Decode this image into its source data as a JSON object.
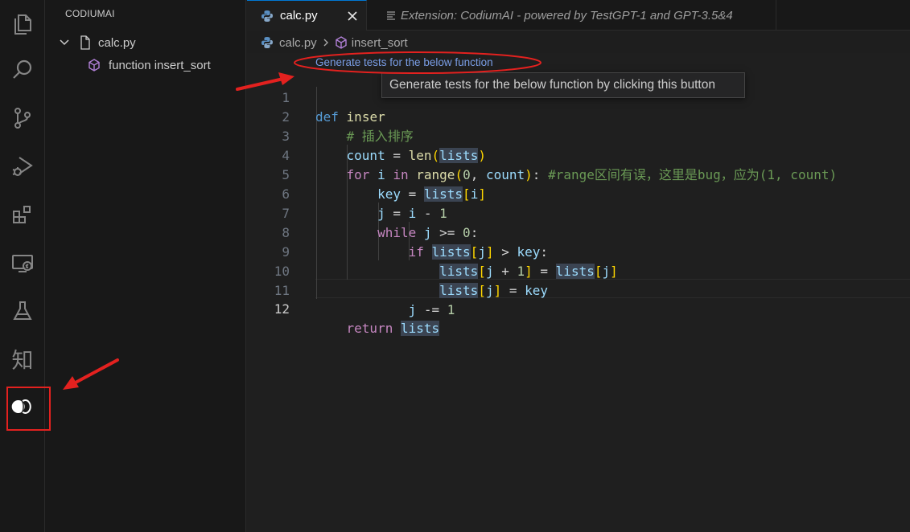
{
  "activity_bar": {
    "items": [
      {
        "name": "explorer",
        "icon": "files-icon"
      },
      {
        "name": "search",
        "icon": "search-icon"
      },
      {
        "name": "source-control",
        "icon": "source-control-icon"
      },
      {
        "name": "run-debug",
        "icon": "run-debug-icon"
      },
      {
        "name": "extensions",
        "icon": "extensions-icon"
      },
      {
        "name": "remote-explorer",
        "icon": "remote-explorer-icon"
      },
      {
        "name": "testing",
        "icon": "flask-icon"
      },
      {
        "name": "zhihu",
        "icon": "zhihu-icon",
        "glyph": "知"
      },
      {
        "name": "codiumai",
        "icon": "codiumai-icon"
      }
    ]
  },
  "sidebar": {
    "title": "CODIUMAI",
    "file": {
      "name": "calc.py"
    },
    "symbol": {
      "label": "function insert_sort"
    }
  },
  "tabs": [
    {
      "label": "calc.py",
      "active": true
    },
    {
      "label": "Extension: CodiumAI - powered by TestGPT-1 and GPT-3.5&4",
      "active": false
    }
  ],
  "breadcrumb": {
    "file": "calc.py",
    "symbol": "insert_sort"
  },
  "codelens": {
    "label": "Generate tests for the below function"
  },
  "tooltip": {
    "text": "Generate tests for the below function by clicking this button"
  },
  "code": {
    "line_numbers": [
      "1",
      "2",
      "3",
      "4",
      "5",
      "6",
      "7",
      "8",
      "9",
      "10",
      "11",
      "12"
    ],
    "current_line": "12",
    "line1": {
      "def": "def",
      "name": "inser"
    },
    "line2": {
      "comment": "# 插入排序"
    },
    "line3": {
      "var": "count",
      "eq": " = ",
      "fn": "len",
      "open": "(",
      "arg": "lists",
      "close": ")"
    },
    "line4": {
      "for": "for",
      "i": "i",
      "in": "in",
      "fn": "range",
      "open": "(",
      "zero": "0",
      "comma": ", ",
      "count": "count",
      "close": ")",
      "colon": ":",
      "comment": "#range区间有误，这里是bug，应为(1, count)"
    },
    "line5": {
      "key": "key",
      "eq": " = ",
      "lists": "lists",
      "lb": "[",
      "i": "i",
      "rb": "]"
    },
    "line6": {
      "j": "j",
      "eq": " = ",
      "i": "i",
      "minus": " - ",
      "one": "1"
    },
    "line7": {
      "while": "while",
      "j": "j",
      "op": " >= ",
      "zero": "0",
      "colon": ":"
    },
    "line8": {
      "if": "if",
      "lists": "lists",
      "lb": "[",
      "j": "j",
      "rb": "]",
      "op": " > ",
      "key": "key",
      "colon": ":"
    },
    "line9": {
      "lists": "lists",
      "lb": "[",
      "j": "j",
      "plus": " + ",
      "one": "1",
      "rb": "]",
      "eq": " = ",
      "lists2": "lists",
      "lb2": "[",
      "j2": "j",
      "rb2": "]"
    },
    "line10": {
      "lists": "lists",
      "lb": "[",
      "j": "j",
      "rb": "]",
      "eq": " = ",
      "key": "key"
    },
    "line11": {
      "j": "j",
      "op": " -= ",
      "one": "1"
    },
    "line12": {
      "return": "return",
      "lists": "lists"
    }
  },
  "colors": {
    "annotation_red": "#e3211f",
    "accent": "#0078d4",
    "codelens": "#7a9ee6"
  }
}
